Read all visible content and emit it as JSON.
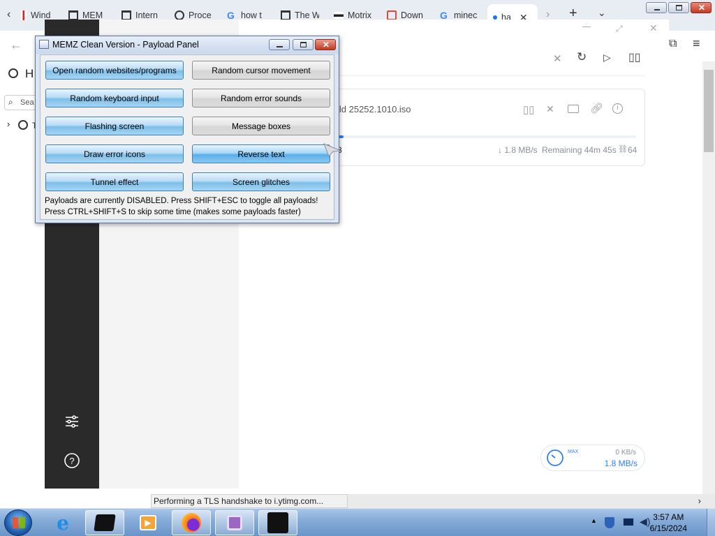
{
  "browser": {
    "tabs": [
      {
        "label": "Wind",
        "icon": "red-flag-icon"
      },
      {
        "label": "MEM",
        "icon": "archive-icon"
      },
      {
        "label": "Intern",
        "icon": "archive-icon"
      },
      {
        "label": "Proce",
        "icon": "gauge-icon"
      },
      {
        "label": "how t",
        "icon": "google-icon"
      },
      {
        "label": "The W",
        "icon": "archive-icon"
      },
      {
        "label": "Motrix",
        "icon": "motrix-icon"
      },
      {
        "label": "Down",
        "icon": "download-page-icon"
      },
      {
        "label": "minec",
        "icon": "google-icon"
      },
      {
        "label": "ha",
        "icon": "loading-dot-icon"
      }
    ],
    "history_heading": "H",
    "search_placeholder": "Sea",
    "tree_item_initial": "T"
  },
  "motrix": {
    "task": {
      "filename": "ild 25252.1010.iso",
      "progress_left": "8",
      "speed": "↓ 1.8 MB/s",
      "remaining": "Remaining 44m 45s",
      "connections": "64",
      "progress": 0.02
    },
    "speed_meter": {
      "max_label": "MAX",
      "upload": "0 KB/s",
      "download": "1.8 MB/s"
    }
  },
  "memz": {
    "title": "MEMZ Clean Version - Payload Panel",
    "buttons": [
      {
        "label": "Open random websites/programs",
        "style": "blue"
      },
      {
        "label": "Random cursor movement",
        "style": "gray"
      },
      {
        "label": "Random keyboard input",
        "style": "blue"
      },
      {
        "label": "Random error sounds",
        "style": "gray"
      },
      {
        "label": "Flashing screen",
        "style": "blue"
      },
      {
        "label": "Message boxes",
        "style": "gray"
      },
      {
        "label": "Draw error icons",
        "style": "blue"
      },
      {
        "label": "Reverse text",
        "style": "blue"
      },
      {
        "label": "Tunnel effect",
        "style": "blue"
      },
      {
        "label": "Screen glitches",
        "style": "blue"
      }
    ],
    "info_line1": "Payloads are currently DISABLED. Press SHIFT+ESC to toggle all payloads!",
    "info_line2": "Press CTRL+SHIFT+S to skip some time (makes some payloads faster)"
  },
  "status_bar": {
    "text": "Performing a TLS handshake to i.ytimg.com..."
  },
  "taskbar": {
    "time": "3:57 AM",
    "date": "6/15/2024"
  },
  "colors": {
    "motrix_accent": "#2f7ff2",
    "memz_button_blue": "#7ebfe9",
    "taskbar": "#86acd9"
  }
}
